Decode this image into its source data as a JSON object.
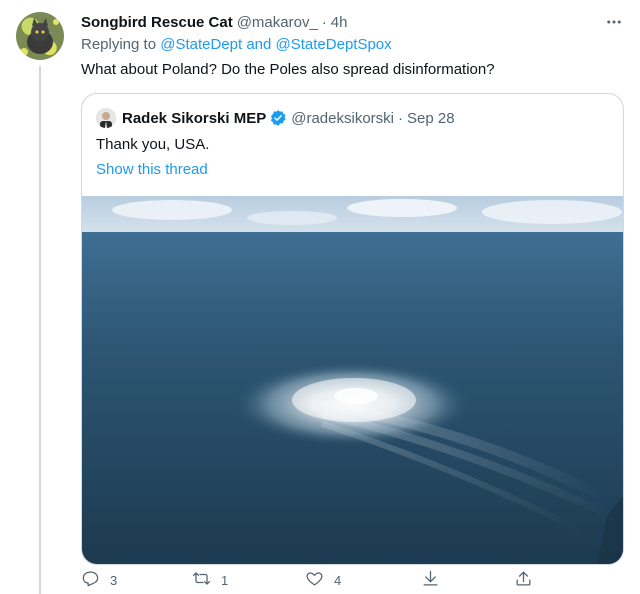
{
  "tweet": {
    "author_name": "Songbird Rescue Cat",
    "author_handle": "@makarov_",
    "separator": "·",
    "time": "4h",
    "replying_prefix": "Replying to ",
    "replying_handles": "@StateDept and @StateDeptSpox",
    "text": "What about Poland? Do the Poles also spread disinformation?",
    "more_icon": "more-dots-icon"
  },
  "quoted": {
    "author_name": "Radek Sikorski MEP",
    "author_handle": "@radeksikorski",
    "separator": "·",
    "date": "Sep 28",
    "text": "Thank you, USA.",
    "show_thread": "Show this thread",
    "verified_color": "#1d9bf0"
  },
  "actions": {
    "reply_count": "3",
    "retweet_count": "1",
    "like_count": "4",
    "icons": [
      "reply-icon",
      "retweet-icon",
      "like-icon",
      "download-icon",
      "share-icon"
    ]
  },
  "colors": {
    "link": "#1d9bf0",
    "muted": "#536471",
    "border": "#cfd9de"
  }
}
